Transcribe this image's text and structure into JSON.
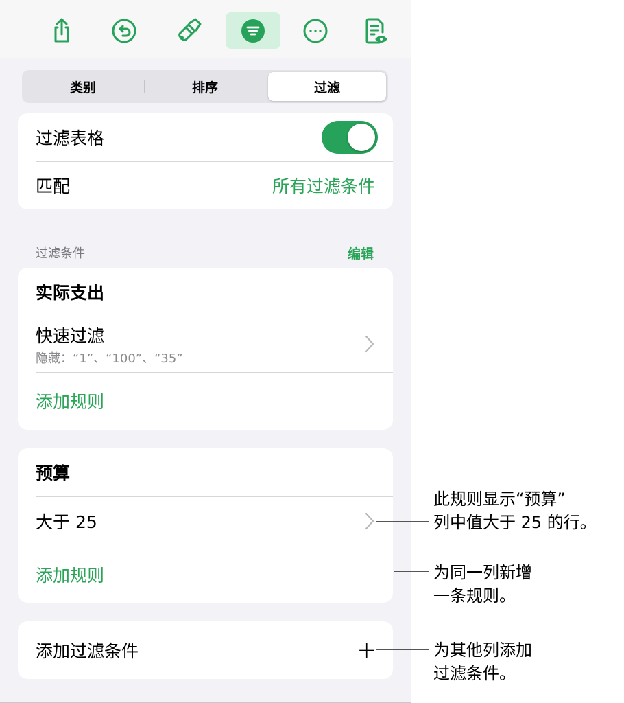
{
  "toolbar": {
    "icons": [
      "share-icon",
      "undo-icon",
      "paintbrush-icon",
      "filter-icon",
      "more-icon",
      "reader-view-icon"
    ],
    "active": "filter-icon",
    "accent": "#27a25a",
    "active_bg": "#d3f1de"
  },
  "tabs": {
    "category": "类别",
    "sort": "排序",
    "filter": "过滤",
    "selected": "过滤"
  },
  "filter_table": {
    "label": "过滤表格",
    "toggle_on": true,
    "match_label": "匹配",
    "match_value": "所有过滤条件"
  },
  "filters_section": {
    "header": "过滤条件",
    "edit": "编辑"
  },
  "filter_actual": {
    "title": "实际支出",
    "rule_title": "快速过滤",
    "rule_subtitle": "隐藏：“1”、“100”、“35”",
    "add_rule": "添加规则"
  },
  "filter_budget": {
    "title": "预算",
    "rule_title": "大于 25",
    "add_rule": "添加规则"
  },
  "add_filter": {
    "label": "添加过滤条件",
    "plus": "+"
  },
  "callouts": {
    "rule": [
      "此规则显示“预算”",
      "列中值大于 25 的行。"
    ],
    "add_rule": [
      "为同一列新增",
      "一条规则。"
    ],
    "add_filter": [
      "为其他列添加",
      "过滤条件。"
    ]
  }
}
